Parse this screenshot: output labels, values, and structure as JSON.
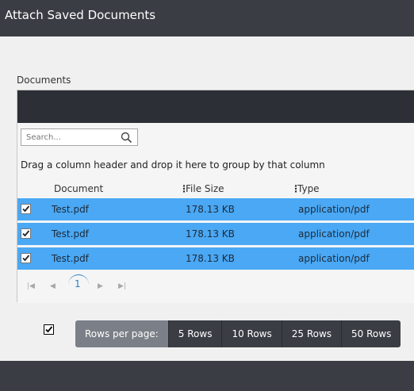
{
  "header": {
    "title": "Attach Saved Documents"
  },
  "documents_label": "Documents",
  "search": {
    "placeholder": "Search..."
  },
  "group_hint": "Drag a column header and drop it here to group by that column",
  "columns": [
    "Document",
    "File Size",
    "Type"
  ],
  "rows": [
    {
      "document": "Test.pdf",
      "file_size": "178.13 KB",
      "type": "application/pdf",
      "checked": true
    },
    {
      "document": "Test.pdf",
      "file_size": "178.13 KB",
      "type": "application/pdf",
      "checked": true
    },
    {
      "document": "Test.pdf",
      "file_size": "178.13 KB",
      "type": "application/pdf",
      "checked": true
    }
  ],
  "pager": {
    "current_page": "1"
  },
  "rows_per_page": {
    "label": "Rows per page:",
    "options": [
      "5 Rows",
      "10 Rows",
      "25 Rows",
      "50 Rows"
    ]
  },
  "icons": {
    "search": "search-icon",
    "first": "first-page-icon",
    "prev": "prev-page-icon",
    "next": "next-page-icon",
    "last": "last-page-icon"
  },
  "colors": {
    "header_bg": "#3b3d45",
    "selected_row": "#4aa8f4",
    "accent": "#2a7fc4"
  }
}
